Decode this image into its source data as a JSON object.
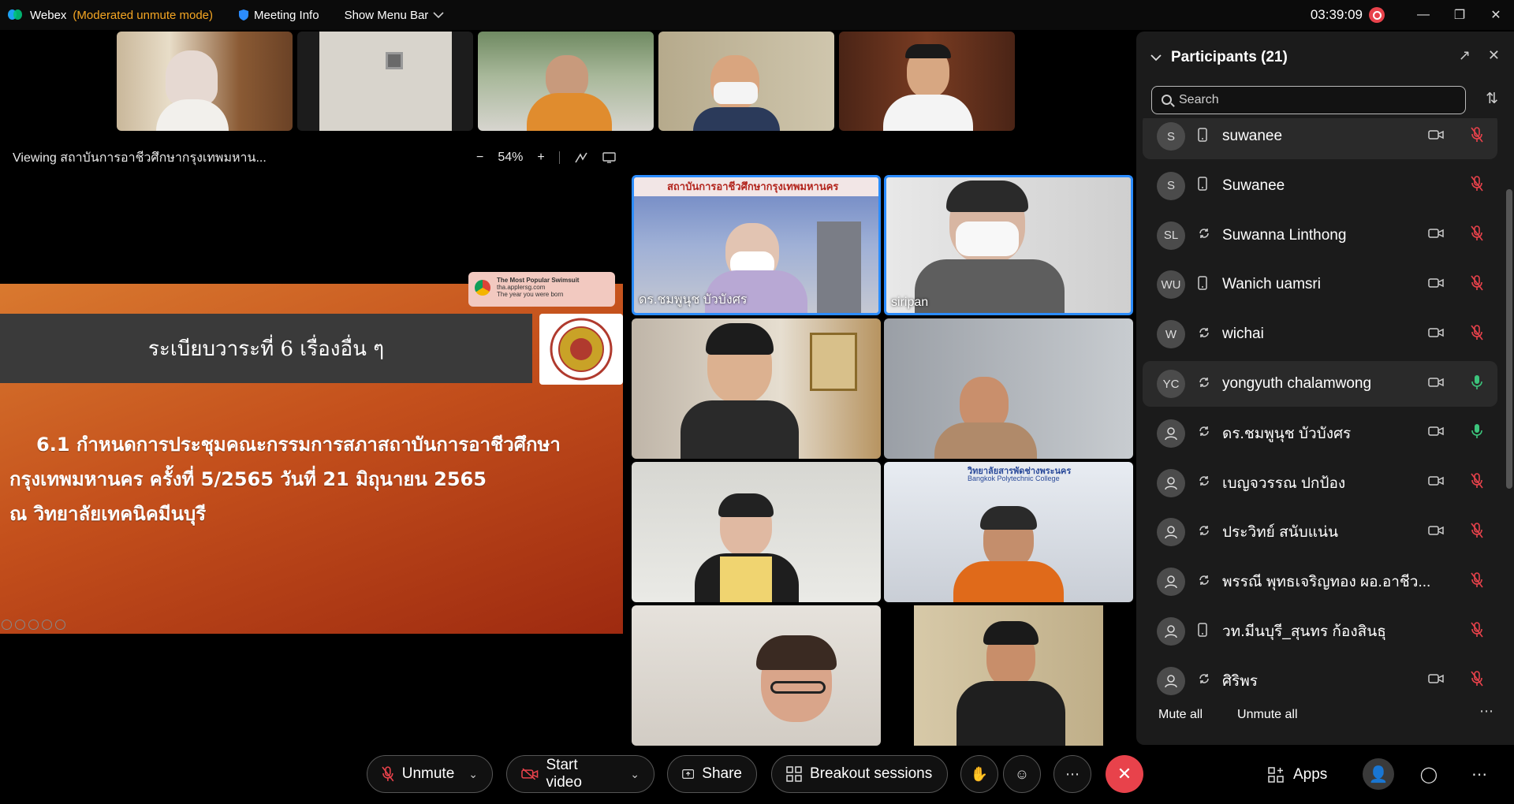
{
  "titlebar": {
    "app_name": "Webex",
    "mode": "(Moderated unmute mode)",
    "meeting_info": "Meeting Info",
    "show_menu_bar": "Show Menu Bar",
    "time": "03:39:09"
  },
  "viewing": {
    "text": "Viewing สถาบันการอาชีวศึกษากรุงเทพมหาน...",
    "zoom_minus": "−",
    "zoom": "54%",
    "zoom_plus": "+"
  },
  "slide": {
    "heading": "ระเบียบวาระที่ 6 เรื่องอื่น ๆ",
    "line1": "6.1 กำหนดการประชุมคณะกรรมการสภาสถาบันการอาชีวศึกษา",
    "line2": "กรุงเทพมหานคร ครั้งที่ 5/2565 วันที่ 21 มิถุนายน  2565",
    "line3": "ณ วิทยาลัยเทคนิคมีนบุรี",
    "ad_title": "The Most Popular Swimsuit",
    "ad_site": "tha.applersg.com",
    "ad_sub": "The year you were born"
  },
  "grid": {
    "tile1_name": "ดร.ชมพูนุช บัวบังศร",
    "tile1_banner": "สถาบันการอาชีวศึกษากรุงเทพมหานคร",
    "tile2_name": "siripan",
    "tile6_banner": "วิทยาลัยสารพัดช่างพระนคร",
    "tile6_sub": "Bangkok Polytechnic College"
  },
  "panel": {
    "title": "Participants (21)",
    "search_placeholder": "Search",
    "mute_all": "Mute all",
    "unmute_all": "Unmute all",
    "participants": [
      {
        "initials": "S",
        "name": "suwanee",
        "device": "phone",
        "video": true,
        "mic": "muted"
      },
      {
        "initials": "S",
        "name": "Suwanee",
        "device": "phone",
        "video": false,
        "mic": "muted"
      },
      {
        "initials": "SL",
        "name": "Suwanna Linthong",
        "device": "sync",
        "video": true,
        "mic": "muted"
      },
      {
        "initials": "WU",
        "name": "Wanich uamsri",
        "device": "phone",
        "video": true,
        "mic": "muted"
      },
      {
        "initials": "W",
        "name": "wichai",
        "device": "sync",
        "video": true,
        "mic": "muted"
      },
      {
        "initials": "YC",
        "name": "yongyuth chalamwong",
        "device": "sync",
        "video": true,
        "mic": "on"
      },
      {
        "initials": "",
        "name": "ดร.ชมพูนุช บัวบังศร",
        "device": "sync",
        "video": true,
        "mic": "on"
      },
      {
        "initials": "",
        "name": "เบญจวรรณ ปกป้อง",
        "device": "sync",
        "video": true,
        "mic": "muted"
      },
      {
        "initials": "",
        "name": "ประวิทย์ สนับแน่น",
        "device": "sync",
        "video": true,
        "mic": "muted"
      },
      {
        "initials": "",
        "name": "พรรณี พุทธเจริญทอง ผอ.อาชีว...",
        "device": "sync",
        "video": false,
        "mic": "muted"
      },
      {
        "initials": "",
        "name": "วท.มีนบุรี_สุนทร ก้องสินธุ",
        "device": "phone",
        "video": false,
        "mic": "muted"
      },
      {
        "initials": "",
        "name": "ศิริพร",
        "device": "sync",
        "video": true,
        "mic": "muted"
      }
    ]
  },
  "toolbar": {
    "unmute": "Unmute",
    "start_video": "Start video",
    "share": "Share",
    "breakout": "Breakout sessions",
    "apps": "Apps"
  },
  "colors": {
    "accent_blue": "#2b8cff",
    "muted_red": "#e8424b",
    "mic_green": "#3cc47c",
    "mode_orange": "#f5a623"
  }
}
